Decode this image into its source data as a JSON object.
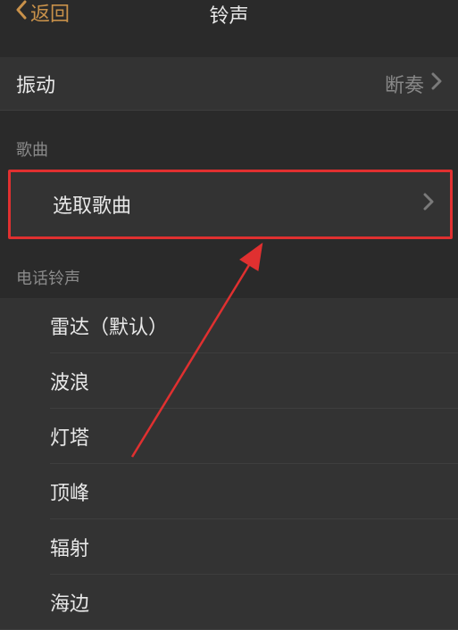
{
  "header": {
    "back_label": "返回",
    "title": "铃声"
  },
  "vibration": {
    "label": "振动",
    "value": "断奏"
  },
  "sections": {
    "song": {
      "header": "歌曲",
      "pick_song_label": "选取歌曲"
    },
    "ringtones": {
      "header": "电话铃声",
      "items": [
        "雷达（默认）",
        "波浪",
        "灯塔",
        "顶峰",
        "辐射",
        "海边"
      ]
    }
  }
}
